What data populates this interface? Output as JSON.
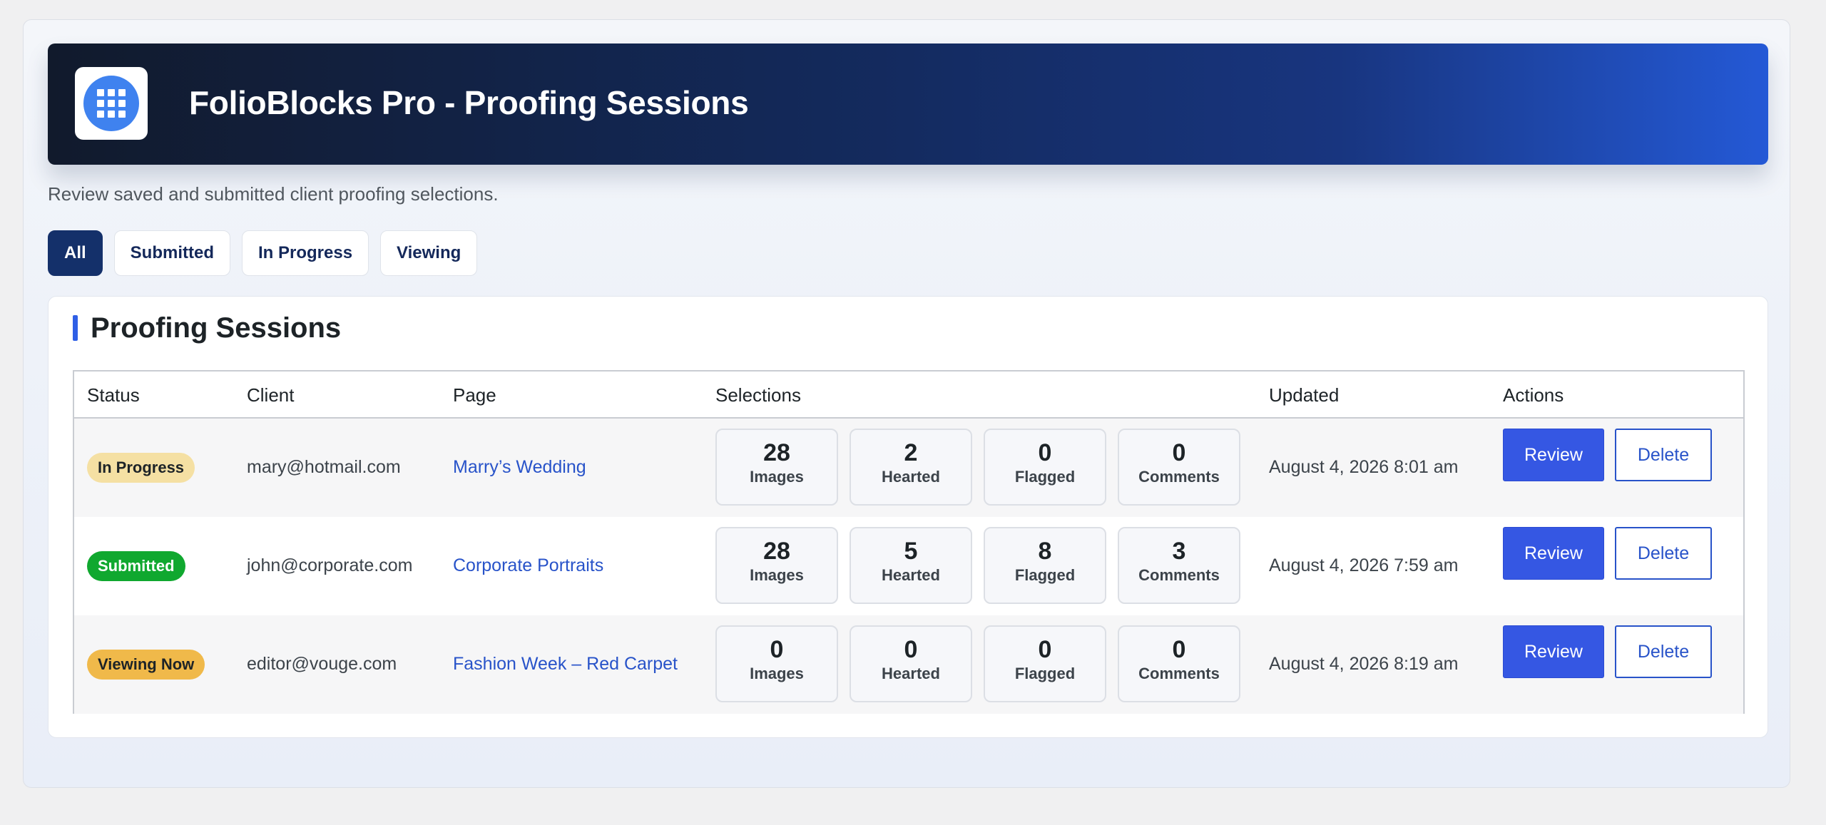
{
  "header": {
    "logo_icon": "grid-icon",
    "title": "FolioBlocks Pro - Proofing Sessions",
    "subtitle": "Review saved and submitted client proofing selections."
  },
  "filters": [
    {
      "label": "All",
      "active": true
    },
    {
      "label": "Submitted",
      "active": false
    },
    {
      "label": "In Progress",
      "active": false
    },
    {
      "label": "Viewing",
      "active": false
    }
  ],
  "panel": {
    "title": "Proofing Sessions",
    "columns": [
      "Status",
      "Client",
      "Page",
      "Selections",
      "Updated",
      "Actions"
    ]
  },
  "rows": [
    {
      "status": "In Progress",
      "status_bg": "#f5e0a3",
      "status_fg": "#1d2327",
      "client": "mary@hotmail.com",
      "page": "Marry’s Wedding",
      "stats": [
        {
          "num": "28",
          "label": "Images"
        },
        {
          "num": "2",
          "label": "Hearted"
        },
        {
          "num": "0",
          "label": "Flagged"
        },
        {
          "num": "0",
          "label": "Comments"
        }
      ],
      "updated": "August 4, 2026 8:01 am",
      "review_label": "Review",
      "delete_label": "Delete"
    },
    {
      "status": "Submitted",
      "status_bg": "#10a82f",
      "status_fg": "#ffffff",
      "client": "john@corporate.com",
      "page": "Corporate Portraits",
      "stats": [
        {
          "num": "28",
          "label": "Images"
        },
        {
          "num": "5",
          "label": "Hearted"
        },
        {
          "num": "8",
          "label": "Flagged"
        },
        {
          "num": "3",
          "label": "Comments"
        }
      ],
      "updated": "August 4, 2026 7:59 am",
      "review_label": "Review",
      "delete_label": "Delete"
    },
    {
      "status": "Viewing Now",
      "status_bg": "#f0b94a",
      "status_fg": "#1d2327",
      "client": "editor@vouge.com",
      "page": "Fashion Week – Red Carpet",
      "stats": [
        {
          "num": "0",
          "label": "Images"
        },
        {
          "num": "0",
          "label": "Hearted"
        },
        {
          "num": "0",
          "label": "Flagged"
        },
        {
          "num": "0",
          "label": "Comments"
        }
      ],
      "updated": "August 4, 2026 8:19 am",
      "review_label": "Review",
      "delete_label": "Delete"
    }
  ]
}
